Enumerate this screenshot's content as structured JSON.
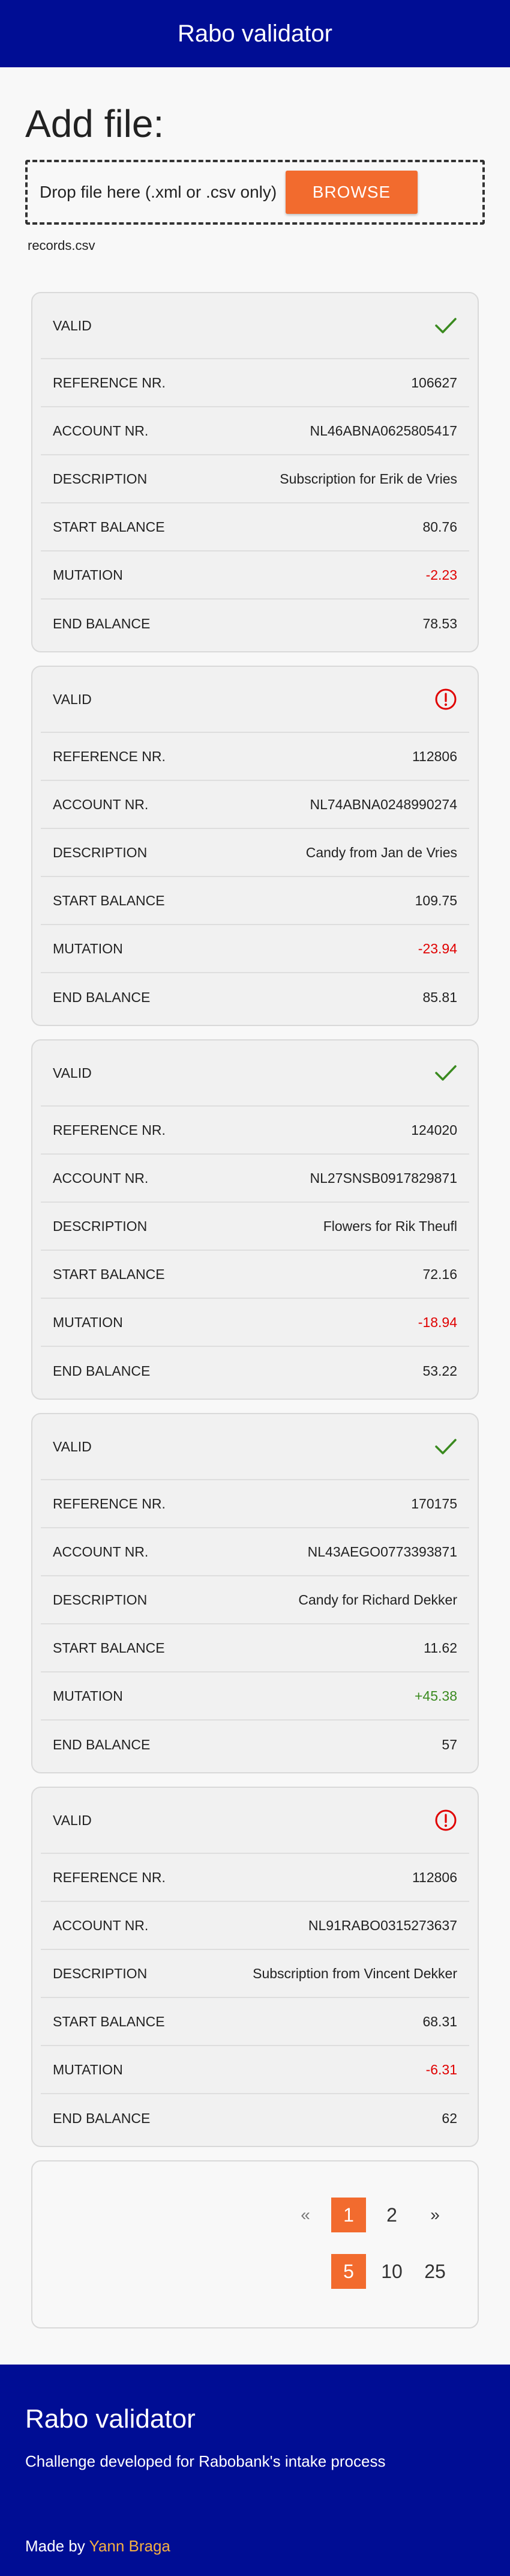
{
  "header": {
    "title": "Rabo validator"
  },
  "upload": {
    "heading": "Add file:",
    "drop_hint": "Drop file here (.xml or .csv only)",
    "browse_label": "BROWSE",
    "filename": "records.csv"
  },
  "labels": {
    "valid": "VALID",
    "reference": "REFERENCE NR.",
    "account": "ACCOUNT NR.",
    "description": "DESCRIPTION",
    "start_balance": "START BALANCE",
    "mutation": "MUTATION",
    "end_balance": "END BALANCE"
  },
  "colors": {
    "brand_blue": "#000d94",
    "accent_orange": "#f26b2e",
    "valid_green": "#3a8a1f",
    "error_red": "#e00000"
  },
  "records": [
    {
      "valid": true,
      "status_icon": "check-icon",
      "reference": "106627",
      "account": "NL46ABNA0625805417",
      "description": "Subscription for Erik de Vries",
      "start_balance": "80.76",
      "mutation": "-2.23",
      "end_balance": "78.53"
    },
    {
      "valid": false,
      "status_icon": "alert-icon",
      "reference": "112806",
      "account": "NL74ABNA0248990274",
      "description": "Candy from Jan de Vries",
      "start_balance": "109.75",
      "mutation": "-23.94",
      "end_balance": "85.81"
    },
    {
      "valid": true,
      "status_icon": "check-icon",
      "reference": "124020",
      "account": "NL27SNSB0917829871",
      "description": "Flowers for Rik Theufl",
      "start_balance": "72.16",
      "mutation": "-18.94",
      "end_balance": "53.22"
    },
    {
      "valid": true,
      "status_icon": "check-icon",
      "reference": "170175",
      "account": "NL43AEGO0773393871",
      "description": "Candy for Richard Dekker",
      "start_balance": "11.62",
      "mutation": "+45.38",
      "end_balance": "57"
    },
    {
      "valid": false,
      "status_icon": "alert-icon",
      "reference": "112806",
      "account": "NL91RABO0315273637",
      "description": "Subscription from Vincent Dekker",
      "start_balance": "68.31",
      "mutation": "-6.31",
      "end_balance": "62"
    }
  ],
  "pagination": {
    "prev": "«",
    "pages": [
      "1",
      "2"
    ],
    "current_page": "1",
    "next": "»",
    "page_sizes": [
      "5",
      "10",
      "25"
    ],
    "current_page_size": "5"
  },
  "footer": {
    "title": "Rabo validator",
    "subtitle": "Challenge developed for Rabobank's intake process",
    "credit_prefix": "Made by",
    "credit_name": "Yann Braga"
  }
}
